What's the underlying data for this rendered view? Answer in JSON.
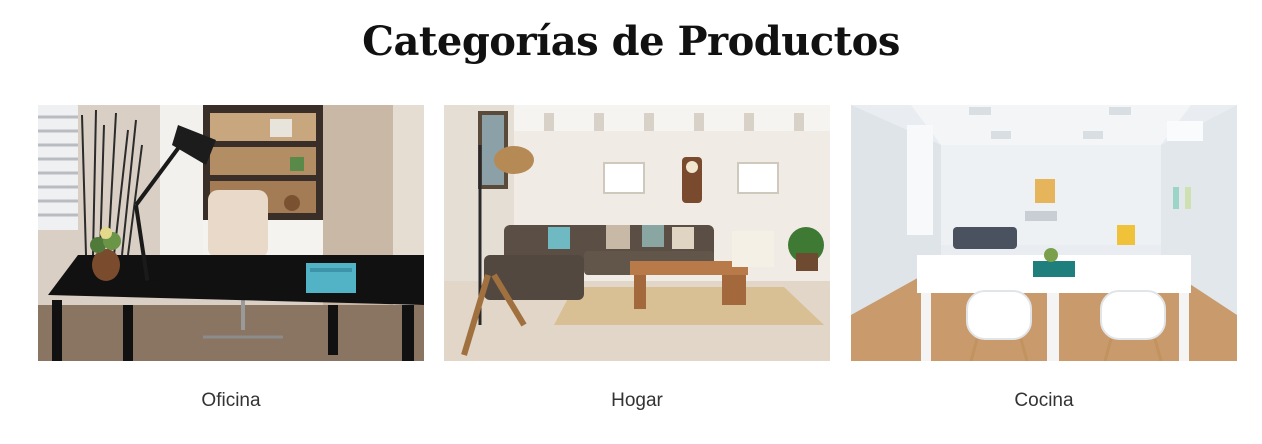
{
  "section": {
    "title": "Categorías de Productos"
  },
  "categories": [
    {
      "label": "Oficina",
      "image": "office-desk-room-photo"
    },
    {
      "label": "Hogar",
      "image": "living-room-sofa-photo"
    },
    {
      "label": "Cocina",
      "image": "white-dining-room-photo"
    }
  ],
  "colors": {
    "title_text": "#111111",
    "label_text": "#333333",
    "background": "#ffffff"
  }
}
